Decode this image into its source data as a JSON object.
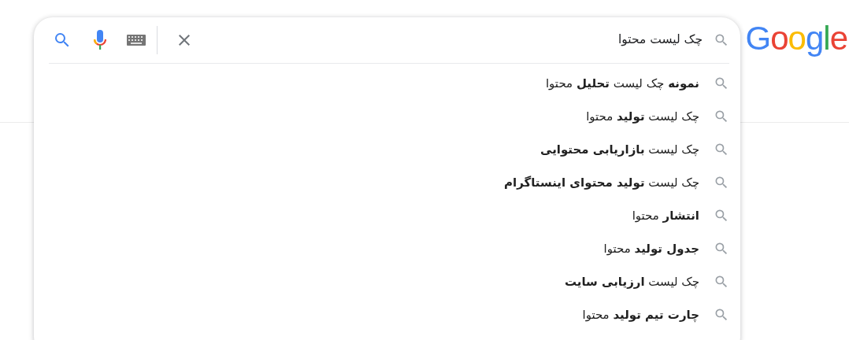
{
  "logo": "Google",
  "search": {
    "value": "چک لیست محتوا"
  },
  "suggestions": [
    {
      "text": "**نمونه** چک لیست **تحلیل** محتوا"
    },
    {
      "text": "چک لیست **تولید** محتوا"
    },
    {
      "text": "چک لیست **بازاریابی محتوایی**"
    },
    {
      "text": "چک لیست **تولید محتوای اینستاگرام**"
    },
    {
      "text": "**انتشار** محتوا"
    },
    {
      "text": "**جدول تولید** محتوا"
    },
    {
      "text": "چک لیست **ارزیابی سایت**"
    },
    {
      "text": "**چارت تیم تولید** محتوا"
    }
  ]
}
